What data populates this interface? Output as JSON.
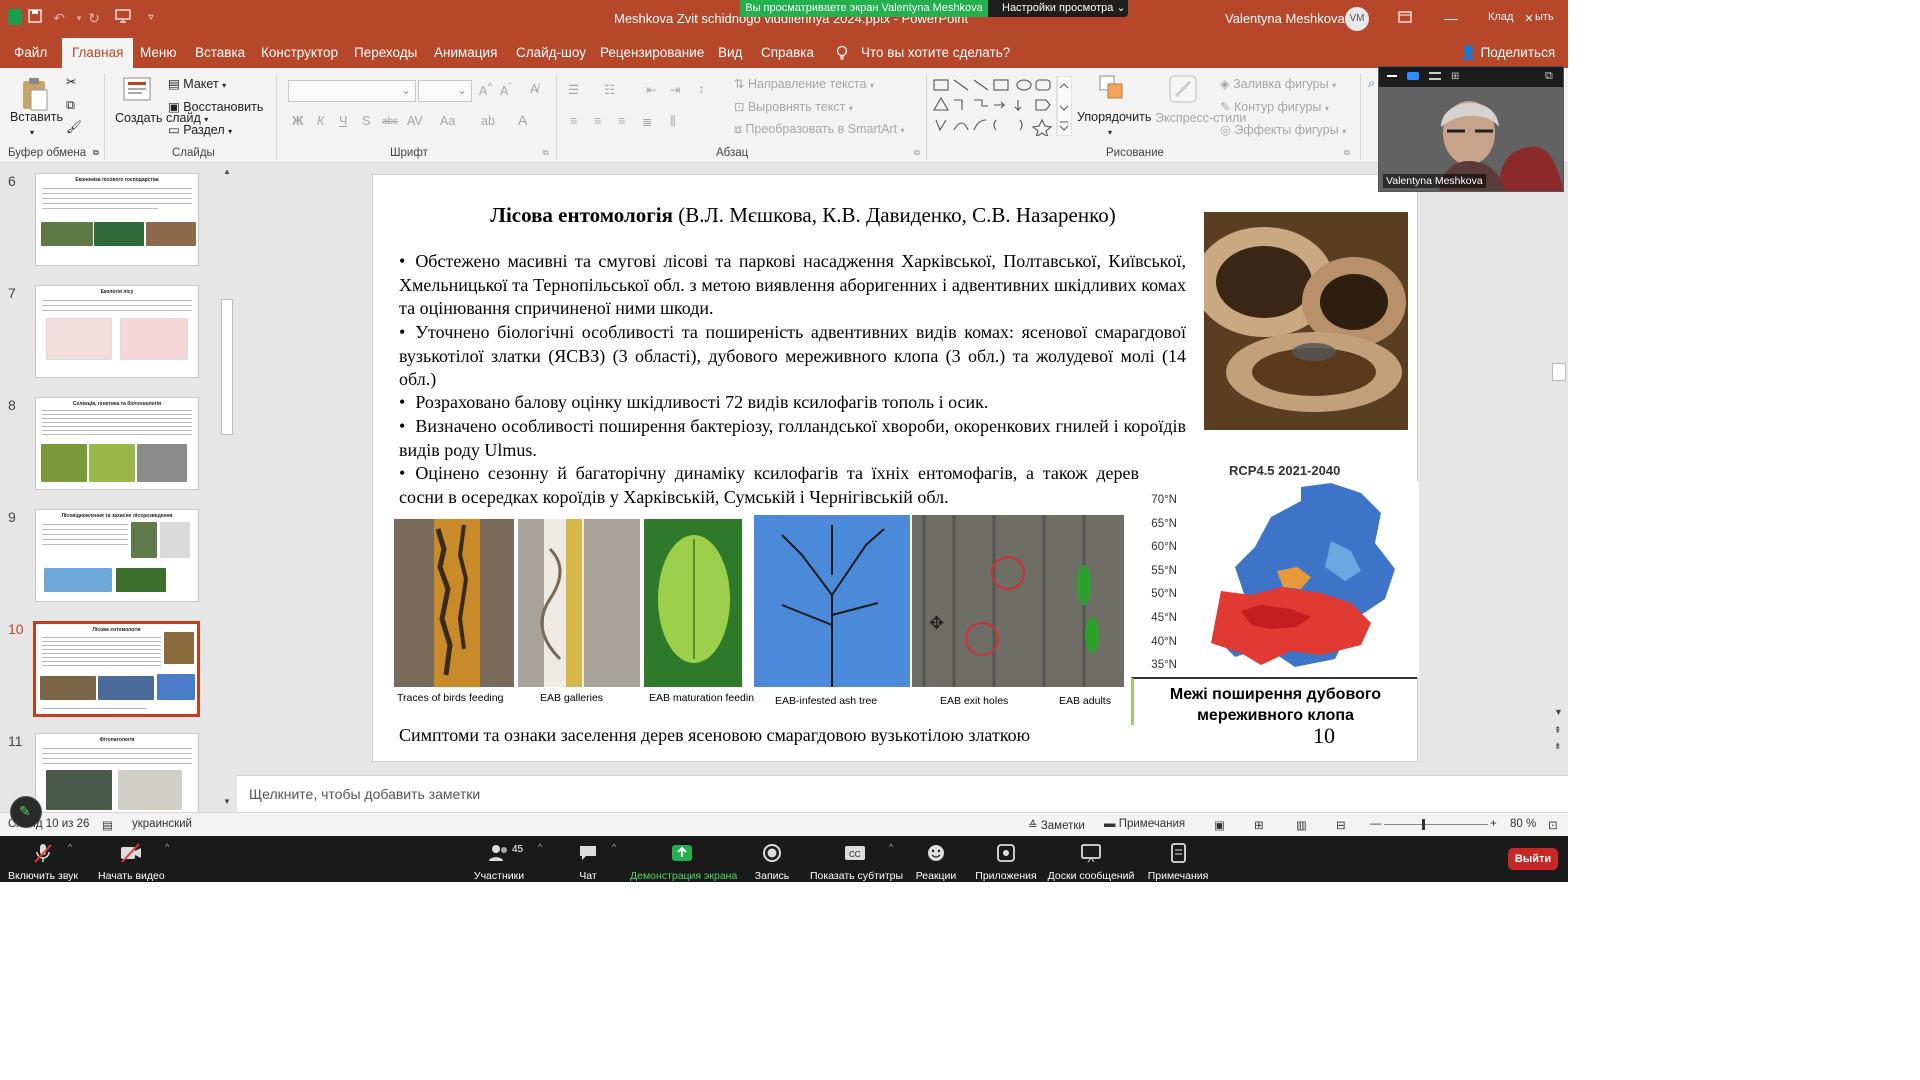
{
  "titlebar": {
    "document_title": "Meshkova Zvit schidnogo viddilennya 2024.pptx - PowerPoint",
    "user_name": "Valentyna Meshkova",
    "user_initials": "VM",
    "share_banner": "Вы просматриваете экран Valentyna Meshkova",
    "view_settings": "Настройки просмотра",
    "toolbar_label": "Клад",
    "window_controls": [
      "minimize-icon",
      "restore-icon",
      "close-icon"
    ]
  },
  "menu": {
    "items": [
      "Файл",
      "Главная",
      "Меню",
      "Вставка",
      "Конструктор",
      "Переходы",
      "Анимация",
      "Слайд-шоу",
      "Рецензирование",
      "Вид",
      "Справка"
    ],
    "active": "Главная",
    "tell_me": "Что вы хотите сделать?",
    "share": "Поделиться"
  },
  "ribbon": {
    "clipboard": {
      "paste": "Вставить",
      "group": "Буфер обмена"
    },
    "slides": {
      "new_slide": "Создать слайд",
      "layout": "Макет",
      "reset": "Восстановить",
      "section": "Раздел",
      "group": "Слайды"
    },
    "font": {
      "group": "Шрифт"
    },
    "paragraph": {
      "text_direction": "Направление текста",
      "align_text": "Выровнять текст",
      "smartart": "Преобразовать в SmartArt",
      "group": "Абзац"
    },
    "drawing": {
      "arrange": "Упорядочить",
      "quick_styles": "Экспресс-стили",
      "shape_fill": "Заливка фигуры",
      "shape_outline": "Контур фигуры",
      "shape_effects": "Эффекты фигуры",
      "group": "Рисование"
    }
  },
  "thumbnails": [
    {
      "number": "6",
      "title": "Економіка лісового господарства"
    },
    {
      "number": "7",
      "title": "Екологія лісу"
    },
    {
      "number": "8",
      "title": "Селекція, генетика та біотехнологія"
    },
    {
      "number": "9",
      "title": "Лісовідновлення та захисне лісорозведення"
    },
    {
      "number": "10",
      "title": "Лісова ентомологія",
      "selected": true
    },
    {
      "number": "11",
      "title": "Фітопатологія"
    }
  ],
  "slide": {
    "title_bold": "Лісова ентомологія",
    "title_rest": " (В.Л. Мєшкова, К.В. Давиденко, С.В. Назаренко)",
    "bullets": [
      "Обстежено масивні та смугові лісові та паркові насадження Харківської, Полтавської, Київської, Хмельницької та Тернопільської обл. з метою виявлення аборигенних і адвентивних шкідливих комах та оцінювання спричиненої ними шкоди.",
      "Уточнено біологічні особливості та поширеність адвентивних видів комах: ясенової смарагдової вузькотілої златки (ЯСВЗ) (3 області), дубового мереживного клопа (3 обл.) та жолудевої молі (14 обл.)",
      "Розраховано балову оцінку шкідливості 72 видів ксилофагів тополь і осик.",
      "Визначено особливості поширення бактеріозу, голландської хвороби, окоренкових гнилей і короїдів видів роду Ulmus.",
      "Оцінено сезонну й багаторічну динаміку ксилофагів та їхніх ентомофагів, а також дерев сосни в осередках короїдів у Харківській, Сумській і Чернігівській обл."
    ],
    "photo_captions": [
      "Traces of birds feeding",
      "EAB galleries",
      "EAB maturation feeding",
      "EAB-infested ash tree",
      "EAB exit holes",
      "EAB adults"
    ],
    "map_title": "RCP4.5 2021-2040",
    "map_lat_labels": [
      "70°N",
      "65°N",
      "60°N",
      "55°N",
      "50°N",
      "45°N",
      "40°N",
      "35°N"
    ],
    "map_caption": "Межі поширення дубового мереживного клопа",
    "bottom_caption": "Симптоми та ознаки заселення дерев ясеновою смарагдовою вузькотілою златкою",
    "slide_number": "10"
  },
  "notes_placeholder": "Щелкните, чтобы добавить заметки",
  "status": {
    "slide_counter": "Слайд 10 из 26",
    "language": "украинский",
    "notes": "Заметки",
    "comments": "Примечания",
    "zoom": "80 %",
    "zoom_level": 0.8
  },
  "video": {
    "participant": "Valentyna Meshkova"
  },
  "zoom_toolbar": {
    "unmute": "Включить звук",
    "start_video": "Начать видео",
    "participants": "Участники",
    "participants_count": "45",
    "chat": "Чат",
    "share_screen": "Демонстрация экрана",
    "record": "Запись",
    "captions": "Показать субтитры",
    "reactions": "Реакции",
    "apps": "Приложения",
    "whiteboards": "Доски сообщений",
    "notes": "Примечания",
    "leave": "Выйти"
  },
  "colors": {
    "accent": "#b7472a",
    "selected": "#c43e1c",
    "zoom_green": "#22b14c",
    "leave": "#c62828"
  }
}
